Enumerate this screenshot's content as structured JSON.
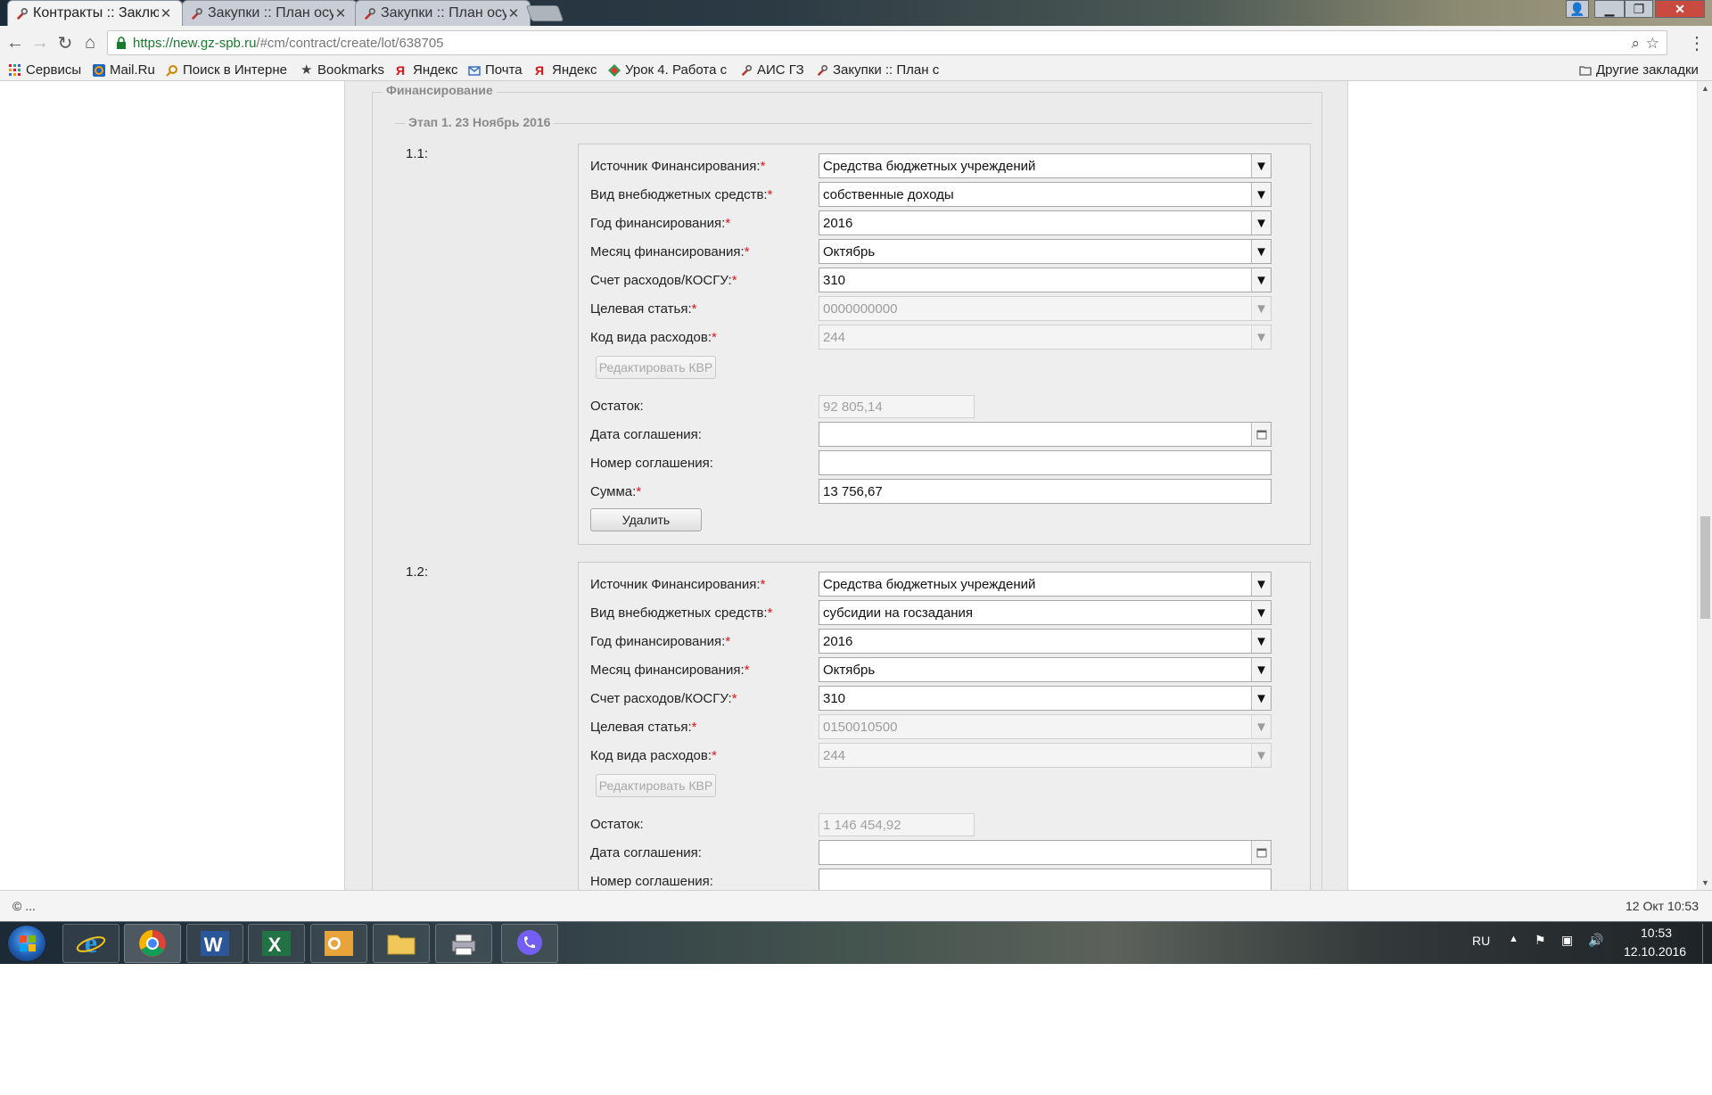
{
  "browser": {
    "tabs": [
      {
        "label": "Контракты :: Заклю",
        "active": true
      },
      {
        "label": "Закупки :: План осу",
        "active": false
      },
      {
        "label": "Закупки :: План осу",
        "active": false
      }
    ],
    "url_host": "https://new.gz-spb.ru",
    "url_path": "/#cm/contract/create/lot/638705",
    "bookmarks": [
      {
        "label": "Сервисы",
        "icon": "apps-grid-icon"
      },
      {
        "label": "Mail.Ru",
        "icon": "mailru-icon"
      },
      {
        "label": "Поиск в Интерне",
        "icon": "search-icon"
      },
      {
        "label": "Bookmarks",
        "icon": "star-icon"
      },
      {
        "label": "Яндекс",
        "icon": "yandex-icon"
      },
      {
        "label": "Почта",
        "icon": "mail-icon"
      },
      {
        "label": "Яндекс",
        "icon": "yandex-icon"
      },
      {
        "label": "Урок 4. Работа с",
        "icon": "lesson-icon"
      },
      {
        "label": "АИС ГЗ",
        "icon": "tools-icon"
      },
      {
        "label": "Закупки :: План с",
        "icon": "tools-icon"
      }
    ],
    "other_bookmarks": "Другие закладки"
  },
  "form": {
    "section_title": "Финансирование",
    "stage_title": "Этап 1. 23 Ноябрь 2016",
    "labels": {
      "source": "Источник Финансирования:",
      "extra_type": "Вид внебюджетных средств:",
      "year": "Год финансирования:",
      "month": "Месяц финансирования:",
      "account": "Счет расходов/КОСГУ:",
      "target": "Целевая статья:",
      "expense_code": "Код вида расходов:",
      "edit_kvr": "Редактировать КВР",
      "remainder": "Остаток:",
      "agreement_date": "Дата соглашения:",
      "agreement_number": "Номер соглашения:",
      "sum": "Сумма:",
      "delete": "Удалить",
      "required_mark": "*"
    },
    "items": [
      {
        "index": "1.1:",
        "source": "Средства бюджетных учреждений",
        "extra_type": "собственные доходы",
        "year": "2016",
        "month": "Октябрь",
        "account": "310",
        "target": "0000000000",
        "expense_code": "244",
        "remainder": "92 805,14",
        "agreement_date": "",
        "agreement_number": "",
        "sum": "13 756,67"
      },
      {
        "index": "1.2:",
        "source": "Средства бюджетных учреждений",
        "extra_type": "субсидии на госзадания",
        "year": "2016",
        "month": "Октябрь",
        "account": "310",
        "target": "0150010500",
        "expense_code": "244",
        "remainder": "1 146 454,92",
        "agreement_date": "",
        "agreement_number": ""
      }
    ]
  },
  "status": {
    "left": "© ...",
    "right": "12 Окт 10:53"
  },
  "taskbar": {
    "lang": "RU",
    "time": "10:53",
    "date": "12.10.2016",
    "apps": [
      "internet-explorer-icon",
      "chrome-icon",
      "word-icon",
      "excel-icon",
      "outlook-icon",
      "explorer-folder-icon",
      "printer-icon",
      "viber-icon"
    ]
  }
}
